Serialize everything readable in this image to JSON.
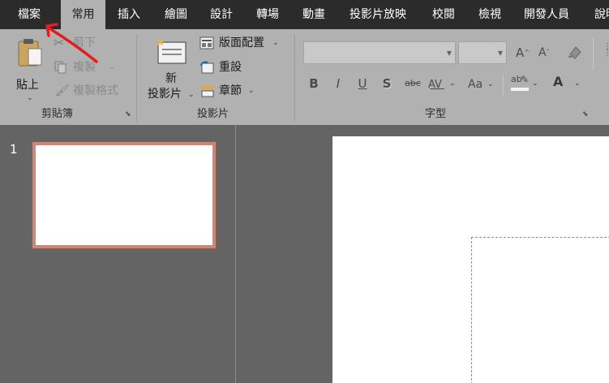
{
  "tabs": {
    "file": "檔案",
    "home": "常用",
    "insert": "插入",
    "draw": "繪圖",
    "design": "設計",
    "transitions": "轉場",
    "animations": "動畫",
    "slideshow": "投影片放映",
    "review": "校閱",
    "view": "檢視",
    "developer": "開發人員",
    "help": "說明"
  },
  "clipboard": {
    "paste": "貼上",
    "cut": "剪下",
    "copy": "複製",
    "format_painter": "複製格式",
    "group_label": "剪貼簿"
  },
  "slides": {
    "new_slide_line1": "新",
    "new_slide_line2": "投影片",
    "layout": "版面配置",
    "reset": "重設",
    "section": "章節",
    "group_label": "投影片"
  },
  "font": {
    "name_value": "",
    "size_value": "",
    "bold": "B",
    "italic": "I",
    "underline": "U",
    "shadow": "S",
    "strikethrough": "abc",
    "spacing": "AV",
    "change_case": "Aa",
    "highlight": "ab",
    "font_color": "A",
    "grow": "A",
    "shrink": "A",
    "group_label": "字型"
  },
  "thumbnails": {
    "slide_number": "1"
  },
  "colors": {
    "tab_bar": "#2b2b2b",
    "ribbon": "#b1b1b1",
    "workspace": "#646464",
    "thumbnail_border": "#c7897a",
    "annotation_arrow": "#e02020"
  }
}
